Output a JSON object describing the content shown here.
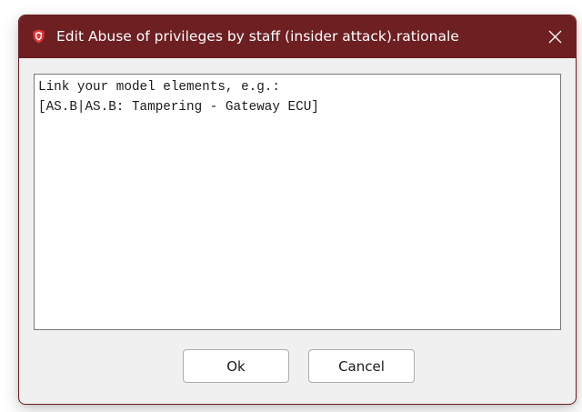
{
  "dialog": {
    "title": "Edit Abuse of privileges by staff (insider attack).rationale",
    "title_icon": "shield-icon",
    "close_icon": "close-icon",
    "colors": {
      "titlebar": "#6d1f22",
      "shield": "#e3353b",
      "body": "#f0f0f0"
    }
  },
  "editor": {
    "lines": [
      "Link your model elements, e.g.:",
      "[AS.B|AS.B: Tampering - Gateway ECU]"
    ]
  },
  "buttons": {
    "ok_label": "Ok",
    "cancel_label": "Cancel"
  }
}
